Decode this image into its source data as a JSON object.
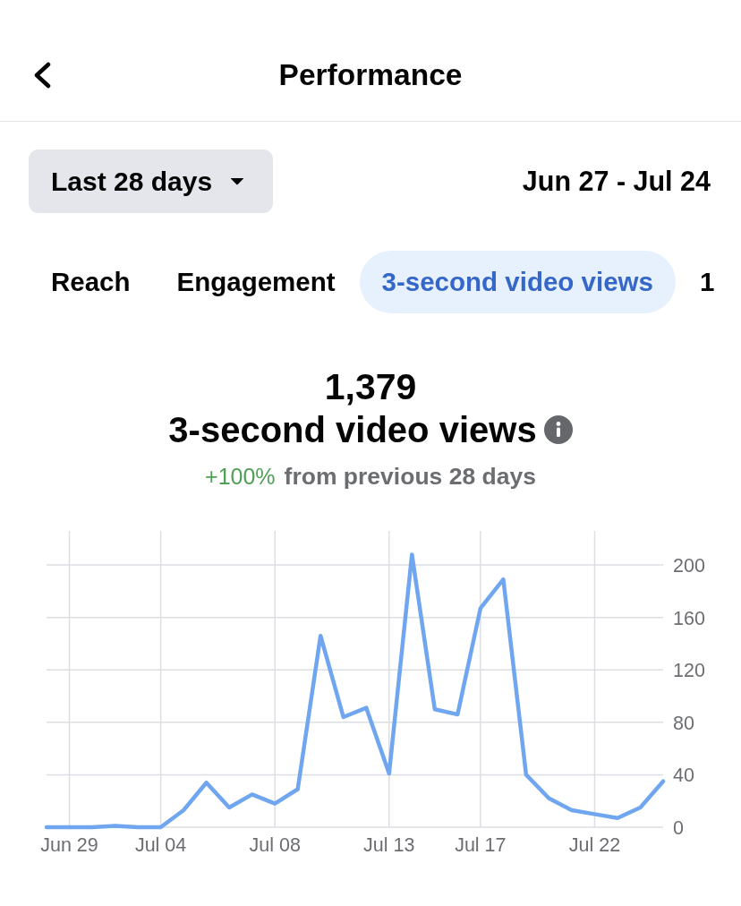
{
  "header": {
    "title": "Performance"
  },
  "filters": {
    "range_dropdown": {
      "label": "Last 28 days"
    },
    "date_range": "Jun 27 - Jul 24"
  },
  "tabs": [
    {
      "label": "Reach",
      "selected": false
    },
    {
      "label": "Engagement",
      "selected": false
    },
    {
      "label": "3-second video views",
      "selected": true
    },
    {
      "label": "1",
      "selected": false
    }
  ],
  "summary": {
    "value": "1,379",
    "metric": "3-second video views",
    "change": "+100%",
    "comparison": "from previous 28 days"
  },
  "chart": {
    "chart_data": {
      "type": "line",
      "categories": [
        null,
        "Jun 29",
        null,
        null,
        null,
        "Jul 04",
        null,
        null,
        null,
        null,
        "Jul 08",
        null,
        null,
        null,
        null,
        "Jul 13",
        null,
        null,
        null,
        "Jul 17",
        null,
        null,
        null,
        null,
        "Jul 22",
        null,
        null,
        null
      ],
      "values": [
        0,
        0,
        0,
        1,
        0,
        0,
        13,
        34,
        15,
        25,
        18,
        29,
        146,
        84,
        91,
        41,
        208,
        90,
        86,
        167,
        189,
        40,
        22,
        13,
        10,
        7,
        15,
        35
      ],
      "ylim": [
        0,
        226
      ],
      "yticks": [
        0,
        40,
        80,
        120,
        160,
        200
      ],
      "grid": true
    }
  }
}
